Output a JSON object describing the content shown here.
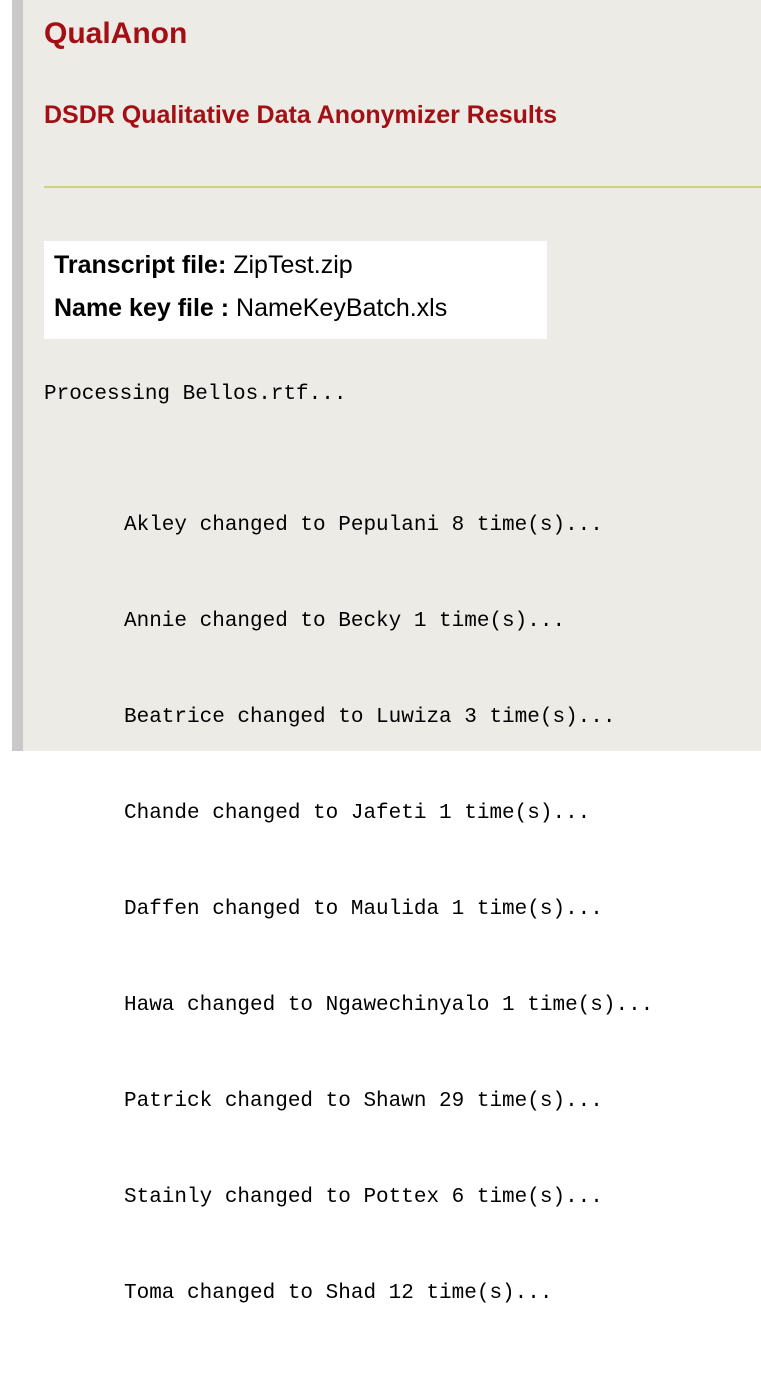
{
  "header": {
    "app_title": "QualAnon",
    "page_subtitle": "DSDR Qualitative Data Anonymizer Results"
  },
  "files": {
    "transcript_label": "Transcript file:",
    "transcript_value": "ZipTest.zip",
    "name_key_label": "Name key file :",
    "name_key_value": "NameKeyBatch.xls"
  },
  "log": {
    "processing_line": "Processing Bellos.rtf...",
    "changes": [
      "Akley changed to Pepulani 8 time(s)...",
      "Annie changed to Becky 1 time(s)...",
      "Beatrice changed to Luwiza 3 time(s)...",
      "Chande changed to Jafeti 1 time(s)...",
      "Daffen changed to Maulida 1 time(s)...",
      "Hawa changed to Ngawechinyalo 1 time(s)...",
      "Patrick changed to Shawn 29 time(s)...",
      "Stainly changed to Pottex 6 time(s)...",
      "Toma changed to Shad 12 time(s)..."
    ]
  },
  "colors": {
    "title_red": "#a30f14",
    "panel_background": "#ecebe6",
    "divider": "#cfcf86",
    "left_border": "#c9c9c9"
  }
}
